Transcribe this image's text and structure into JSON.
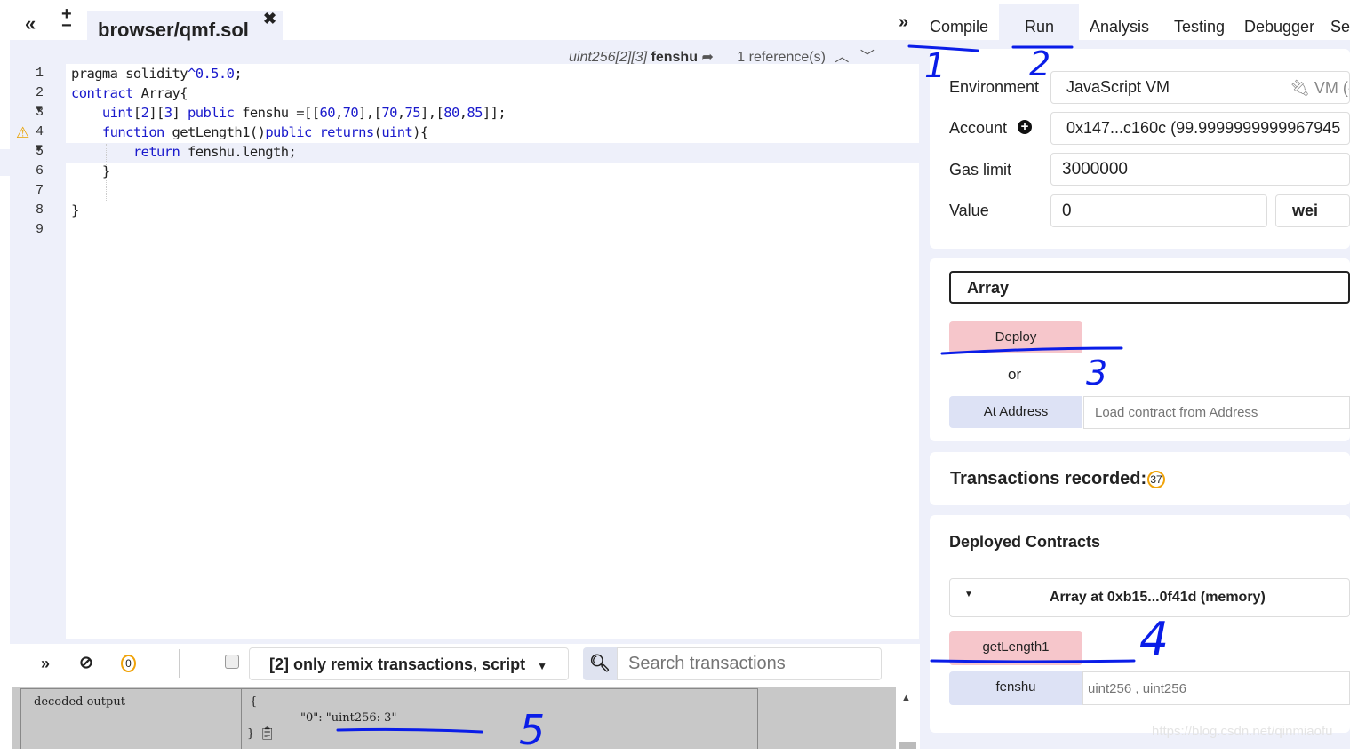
{
  "editor": {
    "collapse_icon": "double-chevron-left",
    "zoom_icon": "plus-minus",
    "tab": "browser/qmf.sol",
    "close_icon": "close",
    "type_info": "uint256[2][3]",
    "type_name": "fenshu",
    "references": "1 reference(s)",
    "lines": [
      {
        "n": "1",
        "segs": [
          [
            "pragma solidity",
            "t"
          ],
          [
            "^0.5.0",
            "n"
          ],
          [
            ";",
            "t"
          ]
        ]
      },
      {
        "n": "2",
        "segs": [
          [
            "contract",
            "k"
          ],
          [
            " Array{",
            "t"
          ]
        ]
      },
      {
        "n": "3",
        "segs": [
          [
            "    uint",
            "k"
          ],
          [
            "[",
            "t"
          ],
          [
            "2",
            "n"
          ],
          [
            "][",
            "t"
          ],
          [
            "3",
            "n"
          ],
          [
            "] ",
            "t"
          ],
          [
            "public",
            "k"
          ],
          [
            " fenshu =[[",
            "t"
          ],
          [
            "60",
            "n"
          ],
          [
            ",",
            "t"
          ],
          [
            "70",
            "n"
          ],
          [
            "],[",
            "t"
          ],
          [
            "70",
            "n"
          ],
          [
            ",",
            "t"
          ],
          [
            "75",
            "n"
          ],
          [
            "],[",
            "t"
          ],
          [
            "80",
            "n"
          ],
          [
            ",",
            "t"
          ],
          [
            "85",
            "n"
          ],
          [
            "]];",
            "t"
          ]
        ]
      },
      {
        "n": "4",
        "segs": [
          [
            "    function",
            "k"
          ],
          [
            " getLength1()",
            "t"
          ],
          [
            "public",
            "k"
          ],
          [
            " ",
            "t"
          ],
          [
            "returns",
            "k"
          ],
          [
            "(",
            "t"
          ],
          [
            "uint",
            "k"
          ],
          [
            "){",
            "t"
          ]
        ]
      },
      {
        "n": "5",
        "segs": [
          [
            "        return",
            "k"
          ],
          [
            " fenshu.length;",
            "t"
          ]
        ]
      },
      {
        "n": "6",
        "segs": [
          [
            "    }",
            "t"
          ]
        ]
      },
      {
        "n": "7",
        "segs": []
      },
      {
        "n": "8",
        "segs": [
          [
            "}",
            "t"
          ]
        ]
      },
      {
        "n": "9",
        "segs": []
      }
    ]
  },
  "terminal": {
    "pending_count": "0",
    "filter": "[2] only remix transactions, script",
    "search_placeholder": "Search transactions",
    "output_label": "decoded output",
    "output_open": "{",
    "output_value": "\"0\": \"uint256: 3\"",
    "output_close": "}"
  },
  "right": {
    "tabs": [
      "Compile",
      "Run",
      "Analysis",
      "Testing",
      "Debugger",
      "Se"
    ],
    "active_tab": "Run",
    "environment_label": "Environment",
    "environment_value": "JavaScript VM",
    "environment_suffix": "VM (-",
    "account_label": "Account",
    "account_value": "0x147...c160c (99.9999999999967945",
    "gas_label": "Gas limit",
    "gas_value": "3000000",
    "value_label": "Value",
    "value_value": "0",
    "value_unit": "wei",
    "contract_select": "Array",
    "deploy": "Deploy",
    "or": "or",
    "at_address": "At Address",
    "at_address_placeholder": "Load contract from Address",
    "tx_recorded": "Transactions recorded:",
    "tx_count": "37",
    "deployed_title": "Deployed Contracts",
    "deployed_instance": "Array at 0xb15...0f41d (memory)",
    "fn1": "getLength1",
    "fn2": "fenshu",
    "fn2_placeholder": "uint256 , uint256"
  },
  "annotations": [
    "1",
    "2",
    "3",
    "4",
    "5"
  ],
  "watermark": "https://blog.csdn.net/qinmiaofu",
  "colors": {
    "accent_bg": "#eef0fa",
    "deploy": "#f6c6cb",
    "button": "#dde2f5",
    "annotation": "#0a1de8",
    "badge": "#f0a30a"
  }
}
